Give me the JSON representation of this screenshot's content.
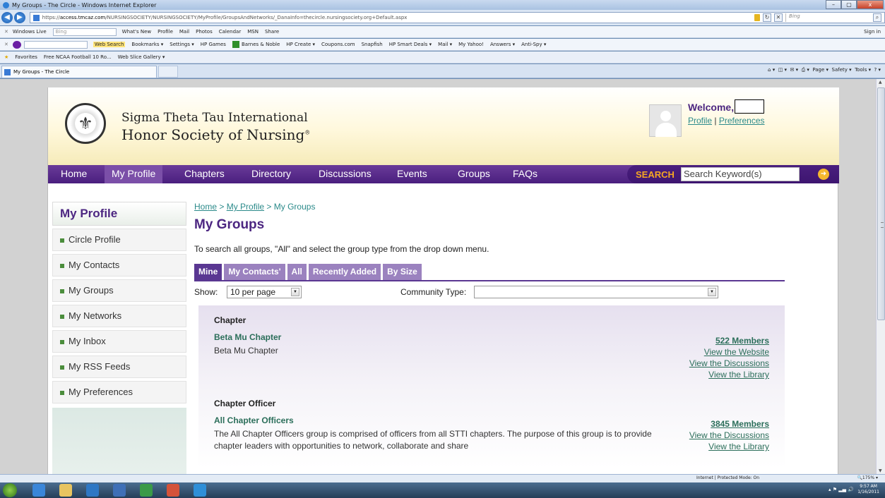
{
  "window": {
    "title": "My Groups - The Circle - Windows Internet Explorer",
    "minimize": "–",
    "maximize": "▢",
    "close": "x"
  },
  "address": {
    "url_prefix": "https://",
    "url_host": "access.tmcaz.com",
    "url_path": "/NURSINGSOCIETY/NURSINGSOCIETY/MyProfile/GroupsAndNetworks/_DanaInfo=thecircle.nursingsociety.org+Default.aspx",
    "search_placeholder": "Bing"
  },
  "toolbar1": {
    "brand": "Windows Live",
    "search_value": "Bing",
    "items": [
      "What's New",
      "Profile",
      "Mail",
      "Photos",
      "Calendar",
      "MSN",
      "Share"
    ],
    "sign_in": "Sign in"
  },
  "toolbar2": {
    "web_search": "Web Search",
    "items": [
      "Bookmarks ▾",
      "Settings ▾",
      "HP Games",
      "Barnes & Noble",
      "HP Create ▾",
      "Coupons.com",
      "Snapfish",
      "HP Smart Deals ▾",
      "Mail ▾",
      "My Yahoo!",
      "Answers ▾",
      "Anti-Spy ▾"
    ]
  },
  "favorites_bar": {
    "favorites": "Favorites",
    "items": [
      "Free NCAA Football 10 Ro...",
      "Web Slice Gallery ▾"
    ]
  },
  "tab": {
    "label": "My Groups - The Circle"
  },
  "command_bar": {
    "items": [
      "Page ▾",
      "Safety ▾",
      "Tools ▾"
    ]
  },
  "site": {
    "org_line1": "Sigma Theta Tau International",
    "org_line2": "Honor Society of Nursing",
    "reg_mark": "®",
    "welcome": "Welcome,",
    "profile_link": "Profile",
    "separator": "|",
    "preferences_link": "Preferences"
  },
  "nav": {
    "items": [
      "Home",
      "My Profile",
      "Chapters",
      "Directory",
      "Discussions",
      "Events",
      "Groups",
      "FAQs"
    ],
    "active": "My Profile",
    "search_label": "SEARCH",
    "search_placeholder": "Search Keyword(s)"
  },
  "sidebar": {
    "title": "My Profile",
    "items": [
      "Circle Profile",
      "My Contacts",
      "My Groups",
      "My Networks",
      "My Inbox",
      "My RSS Feeds",
      "My Preferences"
    ]
  },
  "main": {
    "breadcrumb": [
      "Home",
      "My Profile",
      "My Groups"
    ],
    "breadcrumb_sep": ">",
    "title": "My Groups",
    "intro": "To search all groups, \"All\" and select the group type from the drop down menu.",
    "tabs": [
      "Mine",
      "My Contacts'",
      "All",
      "Recently Added",
      "By Size"
    ],
    "active_tab": "Mine",
    "show_label": "Show:",
    "show_value": "10 per page",
    "community_label": "Community Type:",
    "community_value": ""
  },
  "groups": [
    {
      "type": "Chapter",
      "name": "Beta Mu Chapter",
      "desc": "Beta Mu Chapter",
      "members": "522 Members",
      "links": [
        "View the Website",
        "View the Discussions",
        "View the Library"
      ]
    },
    {
      "type": "Chapter Officer",
      "name": "All Chapter Officers",
      "desc": "The All Chapter Officers group is comprised of officers from all STTI chapters. The purpose of this group is to provide chapter leaders with opportunities to network, collaborate and share",
      "members": "3845 Members",
      "links": [
        "View the Discussions",
        "View the Library"
      ]
    }
  ],
  "status": {
    "zone": "Internet | Protected Mode: On",
    "zoom": "175%"
  },
  "clock": {
    "time": "9:57 AM",
    "date": "1/16/2011"
  },
  "colors": {
    "brand_purple": "#4c2681",
    "nav_purple": "#5a3792",
    "link_teal": "#2b8a8a",
    "search_gold": "#f5a623"
  }
}
